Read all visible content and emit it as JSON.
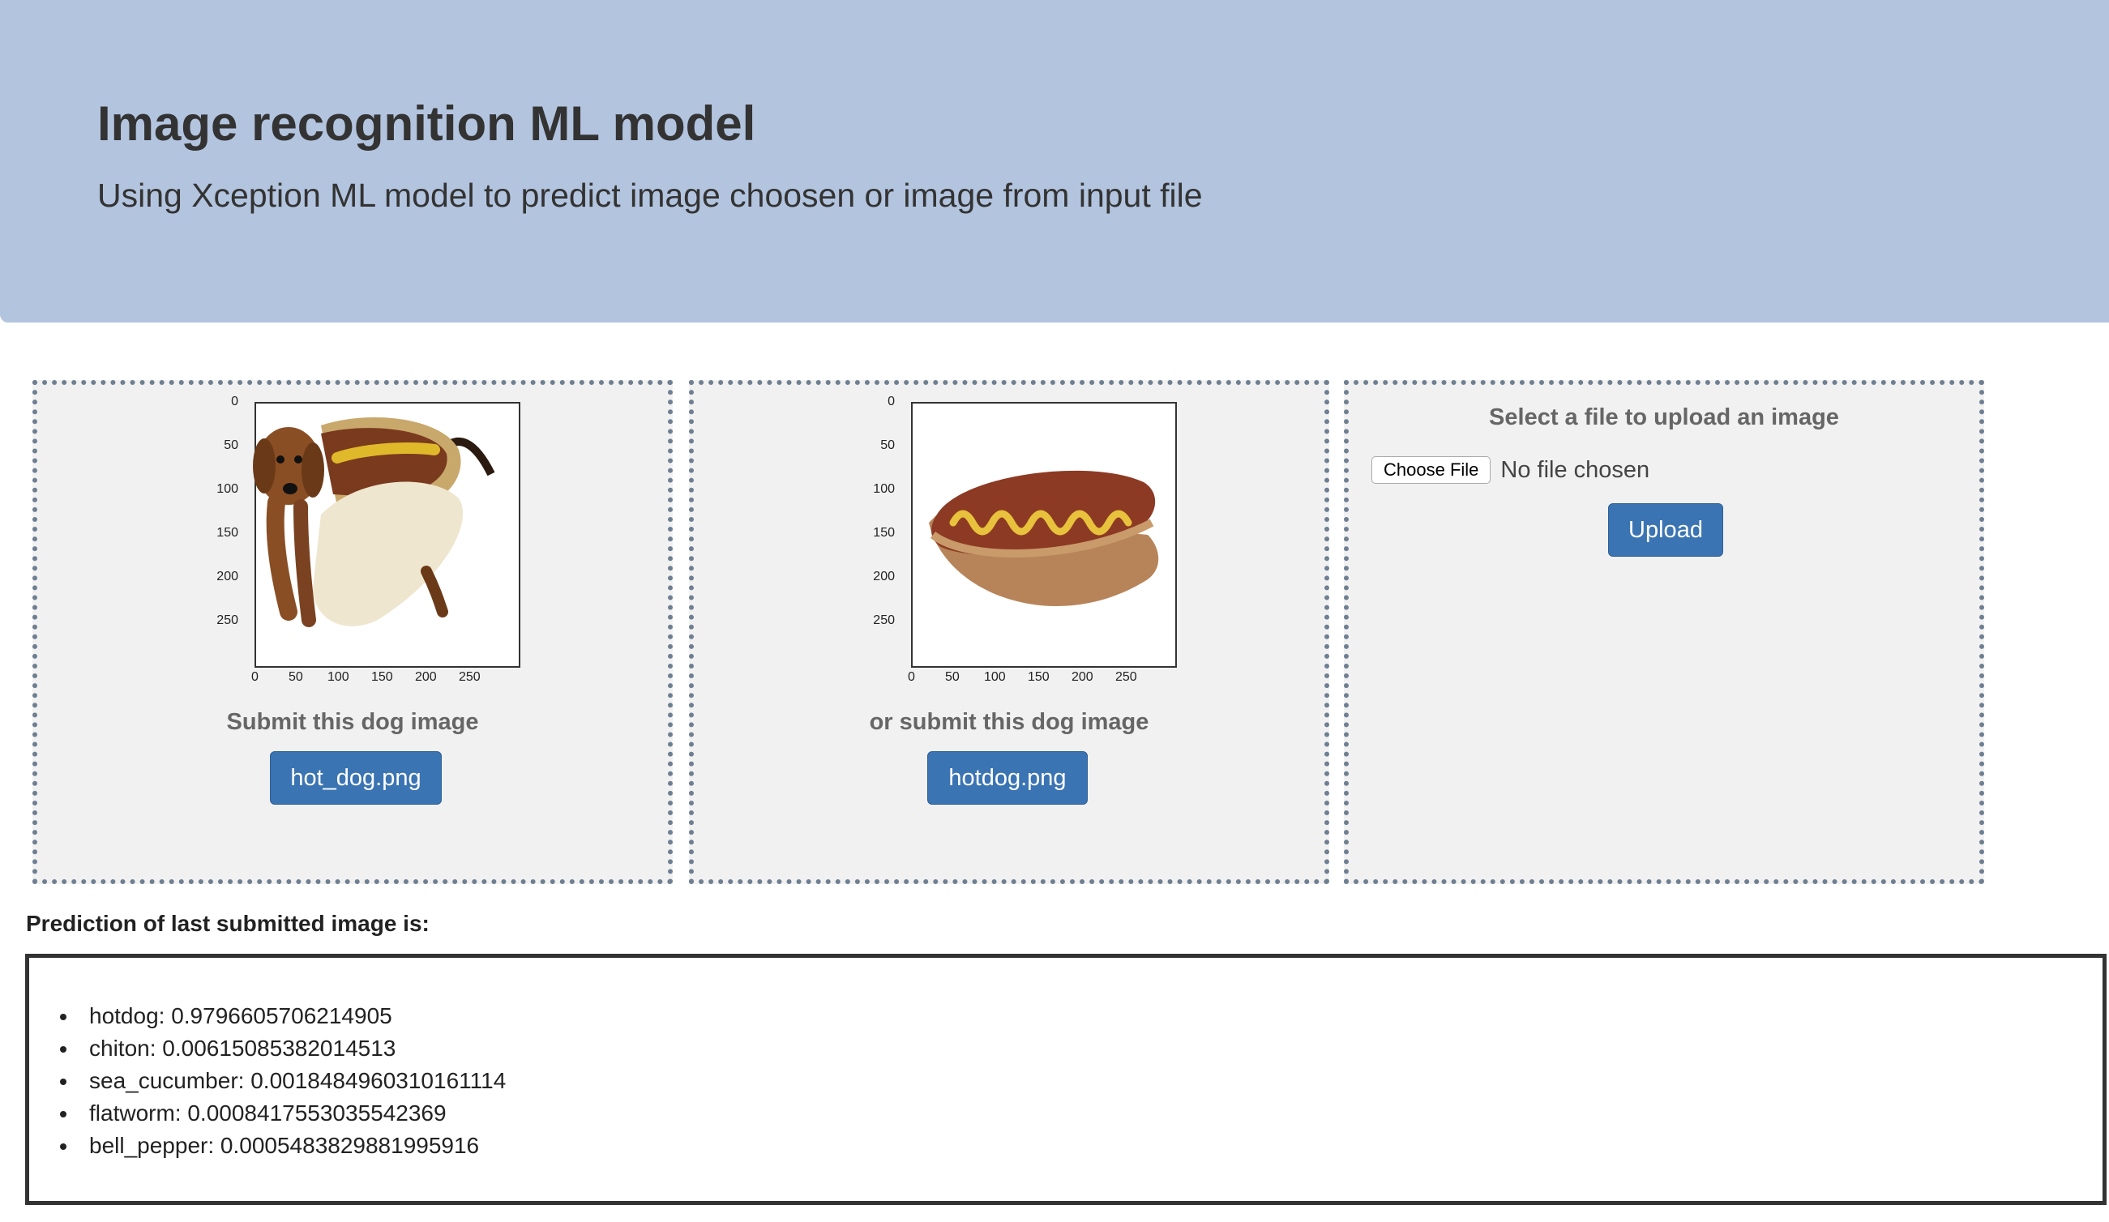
{
  "header": {
    "title": "Image recognition ML model",
    "subtitle": "Using Xception ML model to predict image choosen or image from input file"
  },
  "panels": [
    {
      "image": "dachshund-in-hot-dog-costume",
      "axis_ticks": [
        "0",
        "50",
        "100",
        "150",
        "200",
        "250"
      ],
      "caption": "Submit this dog image",
      "button_label": "hot_dog.png"
    },
    {
      "image": "hot-dog-with-mustard",
      "axis_ticks": [
        "0",
        "50",
        "100",
        "150",
        "200",
        "250"
      ],
      "caption": "or submit this dog image",
      "button_label": "hotdog.png"
    }
  ],
  "upload": {
    "title": "Select a file to upload an image",
    "choose_label": "Choose File",
    "file_status": "No file chosen",
    "button_label": "Upload"
  },
  "predictions": {
    "label": "Prediction of last submitted image is:",
    "items": [
      "hotdog: 0.9796605706214905",
      "chiton: 0.00615085382014513",
      "sea_cucumber: 0.0018484960310161114",
      "flatworm: 0.0008417553035542369",
      "bell_pepper: 0.0005483829881995916"
    ]
  },
  "colors": {
    "jumbotron": "#b3c4df",
    "button": "#3b74b3",
    "panel_bg": "#f1f1f1",
    "panel_border": "#6f7f92"
  }
}
